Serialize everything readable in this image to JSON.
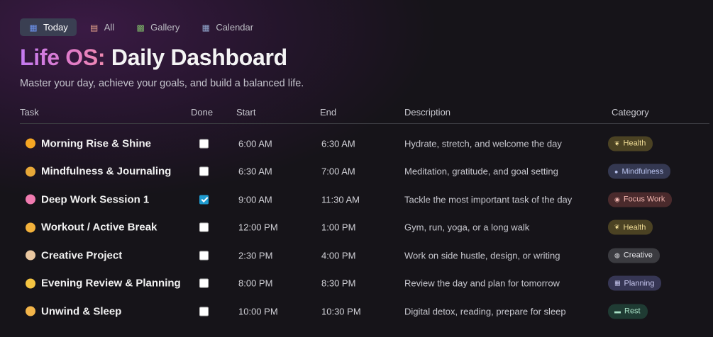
{
  "tabs": [
    {
      "label": "Today",
      "icon": "calendar-icon",
      "glyph": "▦",
      "active": true,
      "color": "#6b8fe8"
    },
    {
      "label": "All",
      "icon": "notepad-icon",
      "glyph": "▤",
      "active": false,
      "color": "#e0a08a"
    },
    {
      "label": "Gallery",
      "icon": "picture-icon",
      "glyph": "▩",
      "active": false,
      "color": "#7fb86a"
    },
    {
      "label": "Calendar",
      "icon": "calendar-icon",
      "glyph": "▦",
      "active": false,
      "color": "#8ea2c8"
    }
  ],
  "title": {
    "brand": "Life OS:",
    "rest": "Daily Dashboard"
  },
  "subtitle": "Master your day, achieve your goals, and build a balanced life.",
  "columns": {
    "task": "Task",
    "done": "Done",
    "start": "Start",
    "end": "End",
    "description": "Description",
    "category": "Category"
  },
  "rows": [
    {
      "task": "Morning Rise & Shine",
      "icon": "sun-icon",
      "icon_color": "#f5a623",
      "done": false,
      "start": "6:00 AM",
      "end": "6:30 AM",
      "description": "Hydrate, stretch, and welcome the day",
      "category": "Health",
      "category_icon": "sprout-icon",
      "category_glyph": "❦",
      "badge_bg": "#4b4223",
      "badge_fg": "#f0dc96"
    },
    {
      "task": "Mindfulness & Journaling",
      "icon": "meditation-icon",
      "icon_color": "#e8a838",
      "done": false,
      "start": "6:30 AM",
      "end": "7:00 AM",
      "description": "Meditation, gratitude, and goal setting",
      "category": "Mindfulness",
      "category_icon": "brain-icon",
      "category_glyph": "●",
      "badge_bg": "#343851",
      "badge_fg": "#b9c3ee"
    },
    {
      "task": "Deep Work Session 1",
      "icon": "brain-icon",
      "icon_color": "#f07bb0",
      "done": true,
      "start": "9:00 AM",
      "end": "11:30 AM",
      "description": "Tackle the most important task of the day",
      "category": "Focus Work",
      "category_icon": "target-icon",
      "category_glyph": "◉",
      "badge_bg": "#4a2a2c",
      "badge_fg": "#f0b4ae"
    },
    {
      "task": "Workout / Active Break",
      "icon": "flexed-arm-icon",
      "icon_color": "#f2b13b",
      "done": false,
      "start": "12:00 PM",
      "end": "1:00 PM",
      "description": "Gym, run, yoga, or a long walk",
      "category": "Health",
      "category_icon": "sprout-icon",
      "category_glyph": "❦",
      "badge_bg": "#4b4223",
      "badge_fg": "#f0dc96"
    },
    {
      "task": "Creative Project",
      "icon": "palette-icon",
      "icon_color": "#e9c7a0",
      "done": false,
      "start": "2:30 PM",
      "end": "4:00 PM",
      "description": "Work on side hustle, design, or writing",
      "category": "Creative",
      "category_icon": "palette-icon",
      "category_glyph": "◍",
      "badge_bg": "#3b3b40",
      "badge_fg": "#e2e2e6"
    },
    {
      "task": "Evening Review & Planning",
      "icon": "moon-icon",
      "icon_color": "#f5c542",
      "done": false,
      "start": "8:00 PM",
      "end": "8:30 PM",
      "description": "Review the day and plan for tomorrow",
      "category": "Planning",
      "category_icon": "calendar-icon",
      "category_glyph": "▦",
      "badge_bg": "#363654",
      "badge_fg": "#c8c8f0"
    },
    {
      "task": "Unwind & Sleep",
      "icon": "sleeping-face-icon",
      "icon_color": "#f3b54a",
      "done": false,
      "start": "10:00 PM",
      "end": "10:30 PM",
      "description": "Digital detox, reading, prepare for sleep",
      "category": "Rest",
      "category_icon": "bed-icon",
      "category_glyph": "▬",
      "badge_bg": "#1f3b33",
      "badge_fg": "#a8e0c6"
    }
  ]
}
